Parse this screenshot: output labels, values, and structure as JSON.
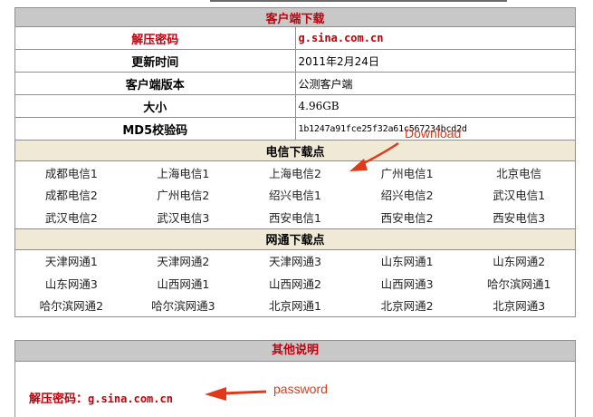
{
  "client": {
    "title": "客户端下载",
    "rows": [
      {
        "label": "解压密码",
        "value": "g.sina.com.cn"
      },
      {
        "label": "更新时间",
        "value": "2011年2月24日"
      },
      {
        "label": "客户端版本",
        "value": "公测客户端"
      },
      {
        "label": "大小",
        "value": "4.96GB"
      },
      {
        "label": "MD5校验码",
        "value": "1b1247a91fce25f32a61c567234bcd2d"
      }
    ]
  },
  "telecom": {
    "title": "电信下载点",
    "mirrors": [
      "成都电信1",
      "上海电信1",
      "上海电信2",
      "广州电信1",
      "北京电信",
      "成都电信2",
      "广州电信2",
      "绍兴电信1",
      "绍兴电信2",
      "武汉电信1",
      "武汉电信2",
      "武汉电信3",
      "西安电信1",
      "西安电信2",
      "西安电信3"
    ]
  },
  "netcom": {
    "title": "网通下载点",
    "mirrors": [
      "天津网通1",
      "天津网通2",
      "天津网通3",
      "山东网通1",
      "山东网通2",
      "山东网通3",
      "山西网通1",
      "山西网通2",
      "山西网通3",
      "哈尔滨网通1",
      "哈尔滨网通2",
      "哈尔滨网通3",
      "北京网通1",
      "北京网通2",
      "北京网通3"
    ]
  },
  "other": {
    "title": "其他说明",
    "password_label": "解压密码：",
    "password_value": "g.sina.com.cn"
  },
  "annotations": {
    "download": "Download",
    "password": "password",
    "color": "#e03a1a"
  }
}
